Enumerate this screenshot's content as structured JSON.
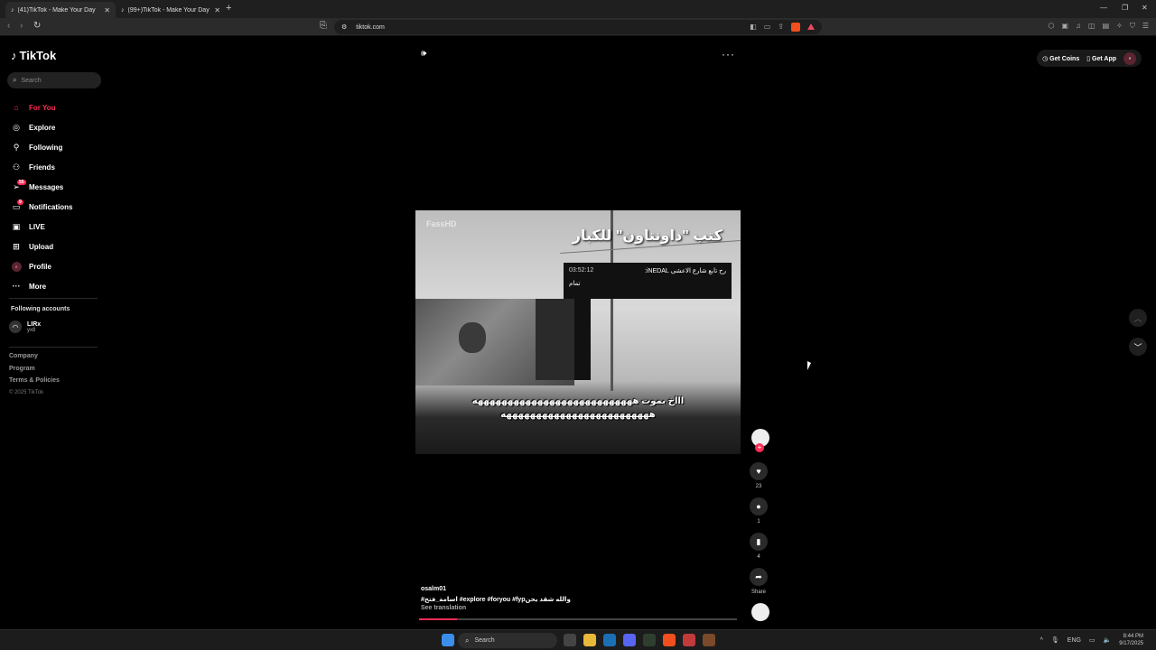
{
  "browser": {
    "tabs": [
      {
        "title": "(41)TikTok - Make Your Day",
        "active": true
      },
      {
        "title": "(99+)TikTok - Make Your Day",
        "active": false
      }
    ],
    "url": "tiktok.com"
  },
  "app": {
    "logo": "TikTok",
    "search_placeholder": "Search",
    "nav": [
      {
        "label": "For You",
        "icon": "home-icon",
        "active": true
      },
      {
        "label": "Explore",
        "icon": "compass-icon"
      },
      {
        "label": "Following",
        "icon": "following-icon"
      },
      {
        "label": "Friends",
        "icon": "friends-icon"
      },
      {
        "label": "Messages",
        "icon": "messages-icon",
        "badge": "55"
      },
      {
        "label": "Notifications",
        "icon": "bell-icon",
        "badge": "9"
      },
      {
        "label": "LIVE",
        "icon": "live-icon"
      },
      {
        "label": "Upload",
        "icon": "upload-icon"
      },
      {
        "label": "Profile",
        "icon": "avatar"
      },
      {
        "label": "More",
        "icon": "more-icon"
      }
    ],
    "following_title": "Following accounts",
    "following_accounts": [
      {
        "name": "LIRx",
        "handle": "yx8"
      }
    ],
    "footer": [
      "Company",
      "Program",
      "Terms & Policies"
    ],
    "copyright": "© 2025 TikTok",
    "header_buttons": {
      "coins": "Get Coins",
      "app": "Get App"
    }
  },
  "video": {
    "title_overlay": "كتب \"داونتاون\" للكبار",
    "watermark": "FassHD",
    "chat_name": "رح تابع شارع الاعشى iNEDAL:",
    "chat_time": "03:52:12",
    "chat_msg": "تمام",
    "caption_line1": "اااخ بموت هههههههههههههههههههههههههههه",
    "caption_line2": "هههههههههههههههههههههههههه",
    "author": "osalm01",
    "description": "#اسامة_فتح #explore #foryou #fypوالله شقد يحن",
    "see_translation": "See translation",
    "progress": 0.12,
    "counts": {
      "likes": "23",
      "comments": "1",
      "saves": "4",
      "share": "Share"
    }
  },
  "taskbar": {
    "search": "Search",
    "lang": "ENG",
    "time": "8:44 PM",
    "date": "9/17/2025"
  },
  "colors": {
    "accent": "#fe2c55",
    "background": "#000000"
  }
}
